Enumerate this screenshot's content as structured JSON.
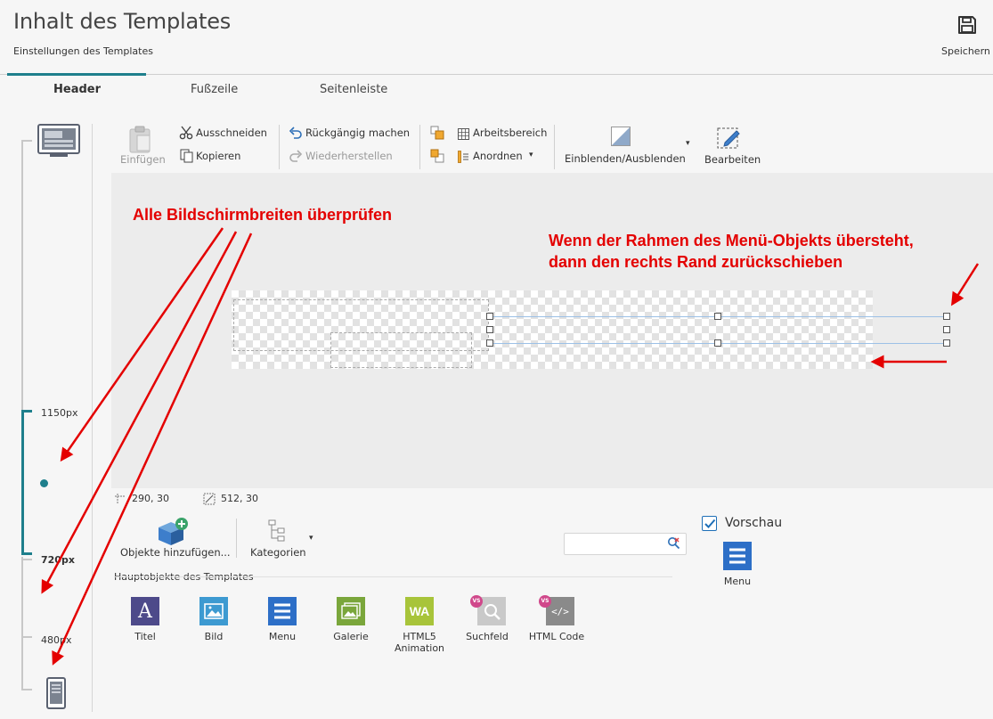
{
  "header": {
    "title": "Inhalt des Templates",
    "subtitle": "Einstellungen des Templates",
    "save_label": "Speichern"
  },
  "tabs": [
    {
      "label": "Header",
      "active": true
    },
    {
      "label": "Fußzeile",
      "active": false
    },
    {
      "label": "Seitenleiste",
      "active": false
    }
  ],
  "breakpoints": {
    "b1": "1150px",
    "b2": "720px",
    "b3": "480px"
  },
  "toolbar": {
    "paste": "Einfügen",
    "cut": "Ausschneiden",
    "copy": "Kopieren",
    "undo": "Rückgängig machen",
    "redo": "Wiederherstellen",
    "workspace": "Arbeitsbereich",
    "arrange": "Anordnen",
    "show_hide": "Einblenden/Ausblenden",
    "edit": "Bearbeiten"
  },
  "annotations": {
    "check_widths": "Alle Bildschirmbreiten überprüfen",
    "menu_note_line1": "Wenn der Rahmen des Menü-Objekts übersteht,",
    "menu_note_line2": "dann den rechts Rand zurückschieben"
  },
  "status": {
    "position": "290, 30",
    "size": "512, 30"
  },
  "objects_panel": {
    "add_objects": "Objekte hinzufügen...",
    "categories": "Kategorien",
    "section_title": "Hauptobjekte des Templates",
    "items": [
      {
        "label": "Titel",
        "icon": "title-icon",
        "color": "#4d4a8a"
      },
      {
        "label": "Bild",
        "icon": "image-icon",
        "color": "#3d9ad1"
      },
      {
        "label": "Menu",
        "icon": "menu-icon",
        "color": "#2d6fc7"
      },
      {
        "label": "Galerie",
        "icon": "gallery-icon",
        "color": "#7aa63b"
      },
      {
        "label": "HTML5\nAnimation",
        "label1": "HTML5",
        "label2": "Animation",
        "icon": "wa-icon",
        "color": "#a8c43a"
      },
      {
        "label": "Suchfeld",
        "icon": "search-field-icon",
        "color": "#c9c9c9"
      },
      {
        "label": "HTML Code",
        "icon": "html-code-icon",
        "color": "#8a8a8a"
      }
    ]
  },
  "preview": {
    "checkbox_label": "Vorschau",
    "checked": true,
    "menu_label": "Menu"
  },
  "colors": {
    "accent": "#1e7f8c",
    "annotation": "#e40000",
    "menu_blue": "#2d6fc7"
  }
}
